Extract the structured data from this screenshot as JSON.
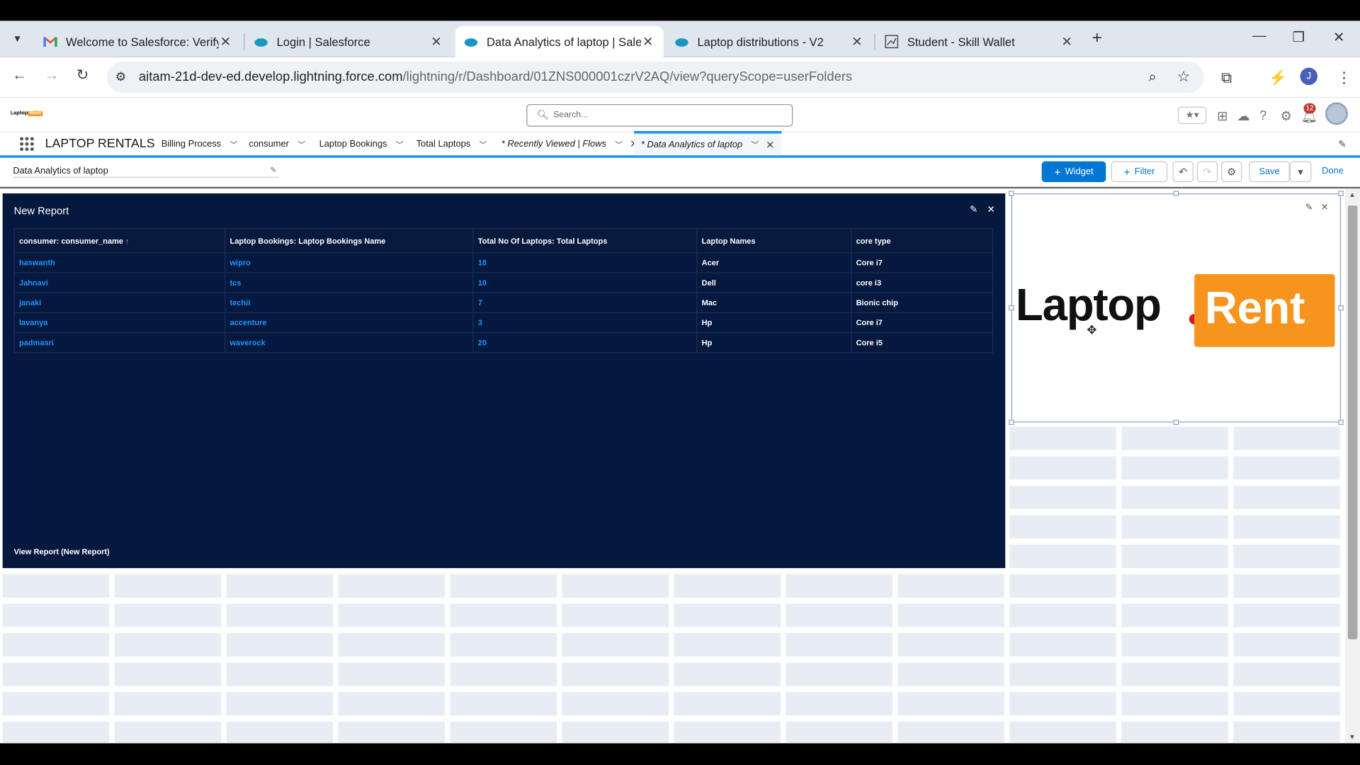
{
  "browser": {
    "tabs": [
      {
        "label": "Welcome to Salesforce: Verify y",
        "icon": "gmail-icon"
      },
      {
        "label": "Login | Salesforce",
        "icon": "salesforce-cloud-icon"
      },
      {
        "label": "Data Analytics of laptop | Salesf",
        "icon": "salesforce-cloud-icon",
        "active": true
      },
      {
        "label": "Laptop distributions - V2",
        "icon": "salesforce-cloud-icon"
      },
      {
        "label": "Student - Skill Wallet",
        "icon": "skill-wallet-icon"
      }
    ],
    "url_host": "aitam-21d-dev-ed.develop.lightning.force.com",
    "url_path": "/lightning/r/Dashboard/01ZNS000001czrV2AQ/view?queryScope=userFolders",
    "profile_initial": "J"
  },
  "sf_header": {
    "logo_left": "Laptop",
    "logo_right": "Rent",
    "search_placeholder": "Search...",
    "notifications_count": "12"
  },
  "nav": {
    "app_name": "LAPTOP RENTALS",
    "items": [
      {
        "label": "Billing Process"
      },
      {
        "label": "consumer"
      },
      {
        "label": "Laptop Bookings"
      },
      {
        "label": "Total Laptops"
      },
      {
        "label": "* Recently Viewed | Flows"
      },
      {
        "label": "* Data Analytics of laptop",
        "active": true
      }
    ]
  },
  "toolbar": {
    "dashboard_title": "Data Analytics of laptop",
    "widget_label": "Widget",
    "filter_label": "Filter",
    "save_label": "Save",
    "done_label": "Done"
  },
  "report": {
    "title": "New Report",
    "columns": [
      "consumer: consumer_name",
      "Laptop Bookings: Laptop Bookings Name",
      "Total No Of Laptops: Total Laptops",
      "Laptop Names",
      "core type"
    ],
    "sort_indicator": "↑",
    "rows": [
      [
        "haswanth",
        "wipro",
        "18",
        "Acer",
        "Core i7"
      ],
      [
        "Jahnavi",
        "tcs",
        "10",
        "Dell",
        "core i3"
      ],
      [
        "janaki",
        "techii",
        "7",
        "Mac",
        "Bionic chip"
      ],
      [
        "lavanya",
        "accenture",
        "3",
        "Hp",
        "Core i7"
      ],
      [
        "padmasri",
        "waverock",
        "20",
        "Hp",
        "Core i5"
      ]
    ],
    "view_link": "View Report (New Report)"
  },
  "image_widget": {
    "logo_text_left": "Laptop",
    "logo_text_right": "Rent"
  },
  "colors": {
    "brand_blue": "#0176d3",
    "report_bg": "#05193f",
    "link_blue": "#1b96ff",
    "logo_orange": "#f7941d"
  }
}
